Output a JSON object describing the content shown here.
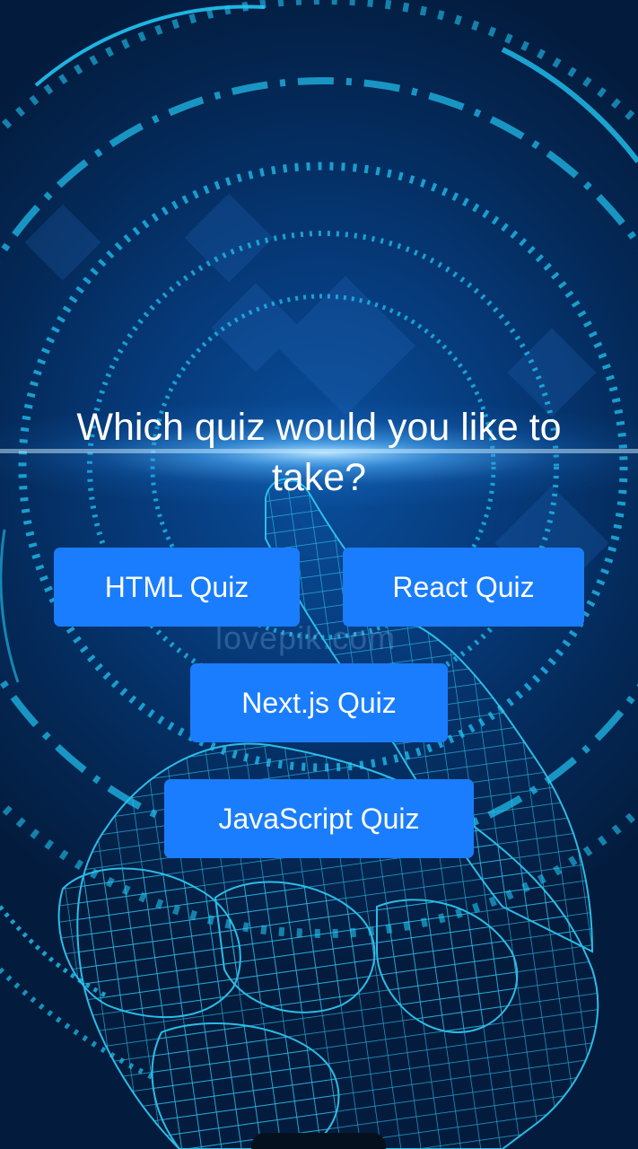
{
  "screen": {
    "title": "Which quiz would you like to take?",
    "watermark": "lovepik.com"
  },
  "quizzes": [
    {
      "label": "HTML Quiz"
    },
    {
      "label": "React Quiz"
    },
    {
      "label": "Next.js Quiz"
    },
    {
      "label": "JavaScript Quiz"
    }
  ],
  "colors": {
    "background": "#04224a",
    "button": "#1a7dfd",
    "text": "#ffffff",
    "accent_lines": "#1ec8f5"
  },
  "icons": [
    "wireframe-hand-background"
  ]
}
